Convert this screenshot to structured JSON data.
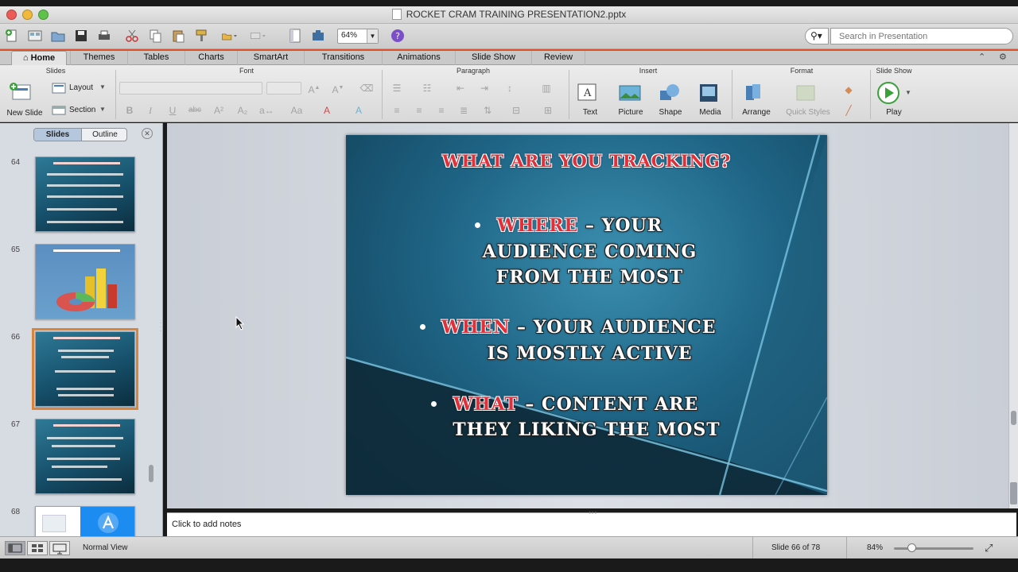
{
  "window": {
    "title": "ROCKET CRAM TRAINING PRESENTATION2.pptx"
  },
  "toolbar": {
    "zoom_value": "64%",
    "search_placeholder": "Search in Presentation"
  },
  "tabs": [
    "Home",
    "Themes",
    "Tables",
    "Charts",
    "SmartArt",
    "Transitions",
    "Animations",
    "Slide Show",
    "Review"
  ],
  "ribbon": {
    "groups": {
      "slides": "Slides",
      "font": "Font",
      "paragraph": "Paragraph",
      "insert": "Insert",
      "format": "Format",
      "slideshow": "Slide Show"
    },
    "new_slide": "New Slide",
    "layout": "Layout",
    "section": "Section",
    "text": "Text",
    "picture": "Picture",
    "shape": "Shape",
    "media": "Media",
    "arrange": "Arrange",
    "quick_styles": "Quick Styles",
    "play": "Play"
  },
  "left_pane": {
    "seg_slides": "Slides",
    "seg_outline": "Outline",
    "slide_numbers": [
      "64",
      "65",
      "66",
      "67",
      "68"
    ]
  },
  "slide": {
    "title": "WHAT ARE YOU TRACKING?",
    "bullets": [
      {
        "key": "WHERE",
        "line1_rest": " – YOUR",
        "line2": "AUDIENCE COMING",
        "line3": "FROM THE MOST"
      },
      {
        "key": "WHEN",
        "line1_rest": " – YOUR AUDIENCE",
        "line2": "IS MOSTLY ACTIVE"
      },
      {
        "key": "WHAT",
        "line1_rest": " – CONTENT ARE",
        "line2": "THEY LIKING THE MOST"
      }
    ]
  },
  "notes": {
    "placeholder": "Click to add notes"
  },
  "status": {
    "view": "Normal View",
    "slide_of": "Slide 66 of 78",
    "zoom": "84%"
  },
  "colors": {
    "accent_tab_bar": "#e04f2a",
    "slide_bg": "#1f6586",
    "key_red": "#e0313a",
    "selection_outline": "#d9853b"
  }
}
